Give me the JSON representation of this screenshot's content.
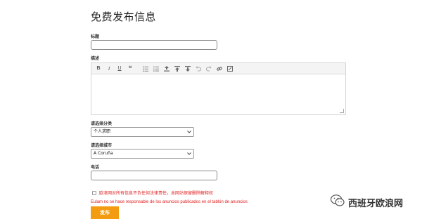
{
  "page": {
    "title": "免费发布信息"
  },
  "form": {
    "title_label": "标题",
    "title_value": "",
    "description_label": "描述",
    "category_label": "请选择分类",
    "category_value": "个人求职",
    "city_label": "请选择城市",
    "city_value": "A Coruña",
    "phone_label": "电话",
    "phone_value": "",
    "disclaimer_cn": "欧浪网对所有信息不负任何法律责任，本网站保留删除解释权",
    "disclaimer_es": "Eulam no se hace responsable de los anuncios publicados en el tablón de anuncios",
    "publish_label": "发布"
  },
  "editor_toolbar": {
    "bold": "B",
    "italic": "I",
    "underline": "U",
    "quote": "❝",
    "icons": [
      "bold-icon",
      "italic-icon",
      "underline-icon",
      "quote-icon",
      "ordered-list-icon",
      "unordered-list-icon",
      "align-left-icon",
      "align-center-icon",
      "align-right-icon",
      "undo-icon",
      "redo-icon",
      "link-icon",
      "unlink-icon"
    ]
  },
  "watermark": {
    "text": "西班牙欧浪网"
  },
  "colors": {
    "accent": "#f39c12",
    "warning": "#e02020"
  }
}
